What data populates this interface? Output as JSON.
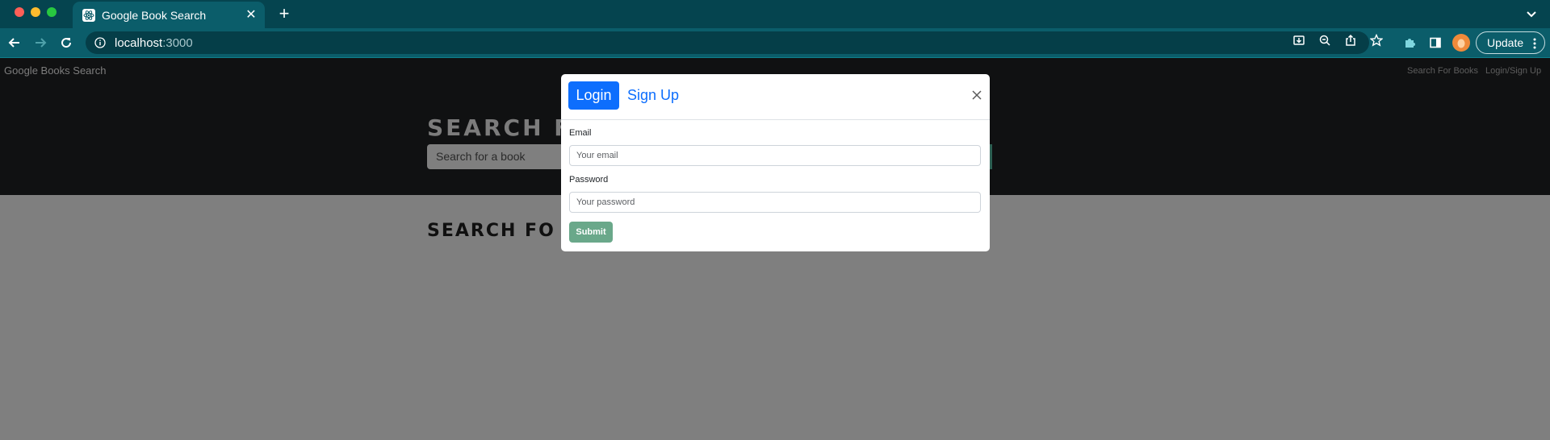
{
  "browser": {
    "tab": {
      "title": "Google Book Search",
      "close_glyph": "✕"
    },
    "new_tab_glyph": "+",
    "url": {
      "host": "localhost",
      "port": ":3000"
    },
    "update_button": {
      "label": "Update"
    },
    "colors": {
      "tab_bar": "#05444f",
      "toolbar": "#0b5d6a",
      "omnibox": "#053e48"
    },
    "icons": [
      "back-icon",
      "forward-icon",
      "reload-icon",
      "site-info-icon",
      "install-icon",
      "zoom-icon",
      "share-icon",
      "bookmark-star-icon",
      "extensions-icon",
      "side-panel-icon",
      "profile-avatar",
      "kebab-menu-icon",
      "tab-list-chevron-icon"
    ]
  },
  "page": {
    "brand": "Google Books Search",
    "nav": {
      "search_link": "Search For Books",
      "login_link": "Login/Sign Up"
    },
    "hero": {
      "heading": "SEARCH F",
      "search_placeholder": "Search for a book"
    },
    "results_heading": "SEARCH FO"
  },
  "modal": {
    "tabs": {
      "login": "Login",
      "signup": "Sign Up"
    },
    "email": {
      "label": "Email",
      "placeholder": "Your email",
      "value": ""
    },
    "password": {
      "label": "Password",
      "placeholder": "Your password",
      "value": ""
    },
    "submit": "Submit",
    "colors": {
      "primary": "#0d6efd",
      "submit_disabled": "#6aa88a"
    }
  }
}
